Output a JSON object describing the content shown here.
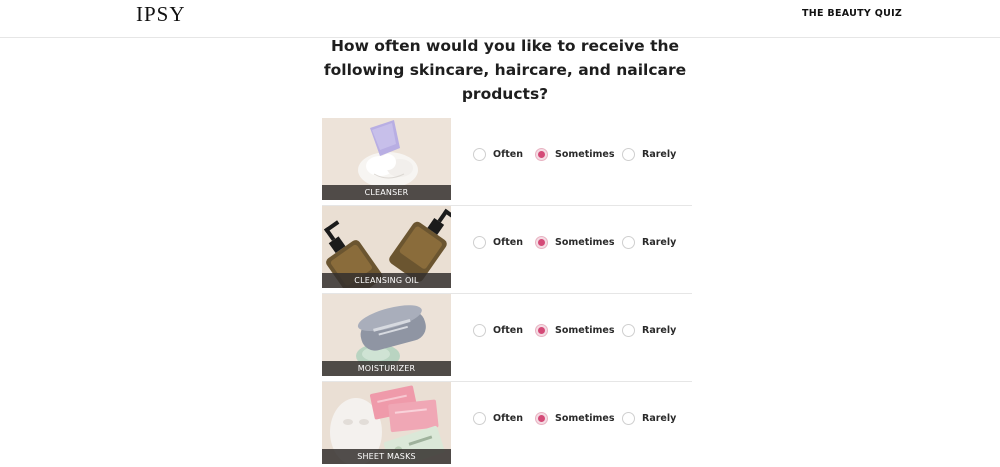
{
  "header": {
    "logo_text": "IPSY",
    "quiz_title": "THE BEAUTY QUIZ"
  },
  "question": {
    "text": "How often would you like to receive the following skincare, haircare, and nailcare products?"
  },
  "option_labels": {
    "often": "Often",
    "sometimes": "Sometimes",
    "rarely": "Rarely"
  },
  "products": [
    {
      "label": "CLEANSER",
      "selected": "Sometimes"
    },
    {
      "label": "CLEANSING OIL",
      "selected": "Sometimes"
    },
    {
      "label": "MOISTURIZER",
      "selected": "Sometimes"
    },
    {
      "label": "SHEET MASKS",
      "selected": "Sometimes"
    }
  ],
  "colors": {
    "accent": "#d44a77",
    "accent_ring": "#f4dbe3",
    "label_bar": "#34302e",
    "divider": "#e6e6e6"
  }
}
